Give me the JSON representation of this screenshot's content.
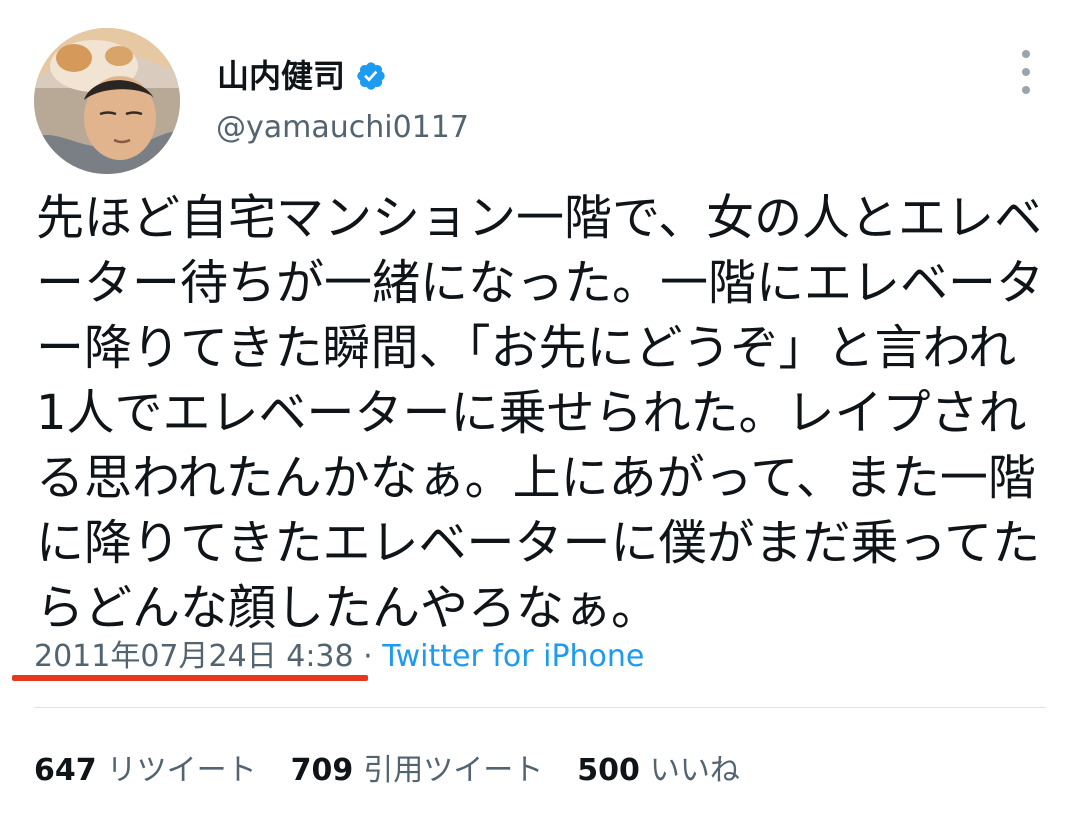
{
  "author": {
    "display_name": "山内健司",
    "handle": "@yamauchi0117",
    "verified": true
  },
  "tweet": {
    "text": "先ほど自宅マンション一階で、女の人とエレベーター待ちが一緒になった。一階にエレベーター降りてきた瞬間、「お先にどうぞ」と言われ1人でエレベーターに乗せられた。レイプされる思われたんかなぁ。上にあがって、また一階に降りてきたエレベーターに僕がまだ乗ってたらどんな顔したんやろなぁ。",
    "datetime": "2011年07月24日 4:38",
    "separator": "·",
    "source": "Twitter for iPhone"
  },
  "stats": [
    {
      "count": "647",
      "label": "リツイート"
    },
    {
      "count": "709",
      "label": "引用ツイート"
    },
    {
      "count": "500",
      "label": "いいね"
    }
  ],
  "icons": {
    "verified": "verified-badge-icon",
    "more": "more-options-icon"
  },
  "colors": {
    "verified": "#1d9bf0",
    "link": "#1d9bf0",
    "secondary_text": "#536471",
    "annotation_underline": "#e8381c"
  }
}
